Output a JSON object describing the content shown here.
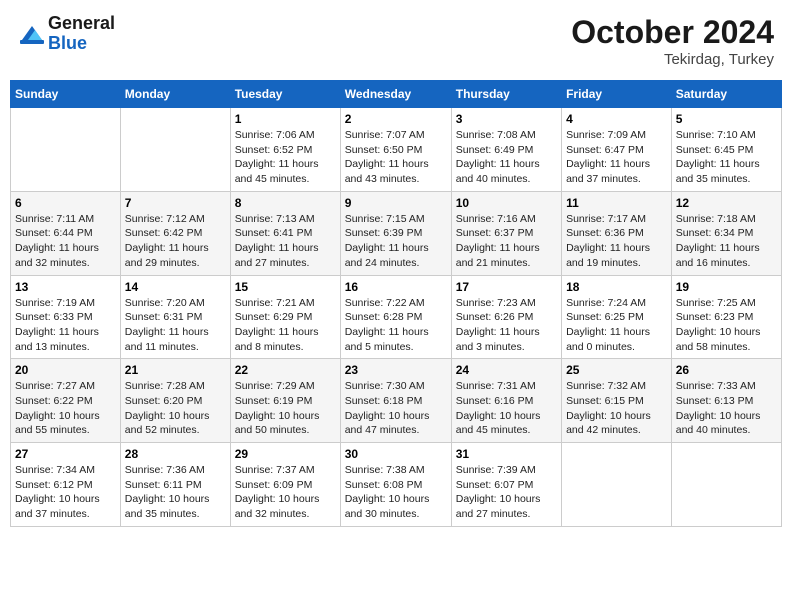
{
  "header": {
    "logo_line1": "General",
    "logo_line2": "Blue",
    "month": "October 2024",
    "location": "Tekirdag, Turkey"
  },
  "weekdays": [
    "Sunday",
    "Monday",
    "Tuesday",
    "Wednesday",
    "Thursday",
    "Friday",
    "Saturday"
  ],
  "weeks": [
    [
      {
        "day": "",
        "info": ""
      },
      {
        "day": "",
        "info": ""
      },
      {
        "day": "1",
        "info": "Sunrise: 7:06 AM\nSunset: 6:52 PM\nDaylight: 11 hours and 45 minutes."
      },
      {
        "day": "2",
        "info": "Sunrise: 7:07 AM\nSunset: 6:50 PM\nDaylight: 11 hours and 43 minutes."
      },
      {
        "day": "3",
        "info": "Sunrise: 7:08 AM\nSunset: 6:49 PM\nDaylight: 11 hours and 40 minutes."
      },
      {
        "day": "4",
        "info": "Sunrise: 7:09 AM\nSunset: 6:47 PM\nDaylight: 11 hours and 37 minutes."
      },
      {
        "day": "5",
        "info": "Sunrise: 7:10 AM\nSunset: 6:45 PM\nDaylight: 11 hours and 35 minutes."
      }
    ],
    [
      {
        "day": "6",
        "info": "Sunrise: 7:11 AM\nSunset: 6:44 PM\nDaylight: 11 hours and 32 minutes."
      },
      {
        "day": "7",
        "info": "Sunrise: 7:12 AM\nSunset: 6:42 PM\nDaylight: 11 hours and 29 minutes."
      },
      {
        "day": "8",
        "info": "Sunrise: 7:13 AM\nSunset: 6:41 PM\nDaylight: 11 hours and 27 minutes."
      },
      {
        "day": "9",
        "info": "Sunrise: 7:15 AM\nSunset: 6:39 PM\nDaylight: 11 hours and 24 minutes."
      },
      {
        "day": "10",
        "info": "Sunrise: 7:16 AM\nSunset: 6:37 PM\nDaylight: 11 hours and 21 minutes."
      },
      {
        "day": "11",
        "info": "Sunrise: 7:17 AM\nSunset: 6:36 PM\nDaylight: 11 hours and 19 minutes."
      },
      {
        "day": "12",
        "info": "Sunrise: 7:18 AM\nSunset: 6:34 PM\nDaylight: 11 hours and 16 minutes."
      }
    ],
    [
      {
        "day": "13",
        "info": "Sunrise: 7:19 AM\nSunset: 6:33 PM\nDaylight: 11 hours and 13 minutes."
      },
      {
        "day": "14",
        "info": "Sunrise: 7:20 AM\nSunset: 6:31 PM\nDaylight: 11 hours and 11 minutes."
      },
      {
        "day": "15",
        "info": "Sunrise: 7:21 AM\nSunset: 6:29 PM\nDaylight: 11 hours and 8 minutes."
      },
      {
        "day": "16",
        "info": "Sunrise: 7:22 AM\nSunset: 6:28 PM\nDaylight: 11 hours and 5 minutes."
      },
      {
        "day": "17",
        "info": "Sunrise: 7:23 AM\nSunset: 6:26 PM\nDaylight: 11 hours and 3 minutes."
      },
      {
        "day": "18",
        "info": "Sunrise: 7:24 AM\nSunset: 6:25 PM\nDaylight: 11 hours and 0 minutes."
      },
      {
        "day": "19",
        "info": "Sunrise: 7:25 AM\nSunset: 6:23 PM\nDaylight: 10 hours and 58 minutes."
      }
    ],
    [
      {
        "day": "20",
        "info": "Sunrise: 7:27 AM\nSunset: 6:22 PM\nDaylight: 10 hours and 55 minutes."
      },
      {
        "day": "21",
        "info": "Sunrise: 7:28 AM\nSunset: 6:20 PM\nDaylight: 10 hours and 52 minutes."
      },
      {
        "day": "22",
        "info": "Sunrise: 7:29 AM\nSunset: 6:19 PM\nDaylight: 10 hours and 50 minutes."
      },
      {
        "day": "23",
        "info": "Sunrise: 7:30 AM\nSunset: 6:18 PM\nDaylight: 10 hours and 47 minutes."
      },
      {
        "day": "24",
        "info": "Sunrise: 7:31 AM\nSunset: 6:16 PM\nDaylight: 10 hours and 45 minutes."
      },
      {
        "day": "25",
        "info": "Sunrise: 7:32 AM\nSunset: 6:15 PM\nDaylight: 10 hours and 42 minutes."
      },
      {
        "day": "26",
        "info": "Sunrise: 7:33 AM\nSunset: 6:13 PM\nDaylight: 10 hours and 40 minutes."
      }
    ],
    [
      {
        "day": "27",
        "info": "Sunrise: 7:34 AM\nSunset: 6:12 PM\nDaylight: 10 hours and 37 minutes."
      },
      {
        "day": "28",
        "info": "Sunrise: 7:36 AM\nSunset: 6:11 PM\nDaylight: 10 hours and 35 minutes."
      },
      {
        "day": "29",
        "info": "Sunrise: 7:37 AM\nSunset: 6:09 PM\nDaylight: 10 hours and 32 minutes."
      },
      {
        "day": "30",
        "info": "Sunrise: 7:38 AM\nSunset: 6:08 PM\nDaylight: 10 hours and 30 minutes."
      },
      {
        "day": "31",
        "info": "Sunrise: 7:39 AM\nSunset: 6:07 PM\nDaylight: 10 hours and 27 minutes."
      },
      {
        "day": "",
        "info": ""
      },
      {
        "day": "",
        "info": ""
      }
    ]
  ]
}
